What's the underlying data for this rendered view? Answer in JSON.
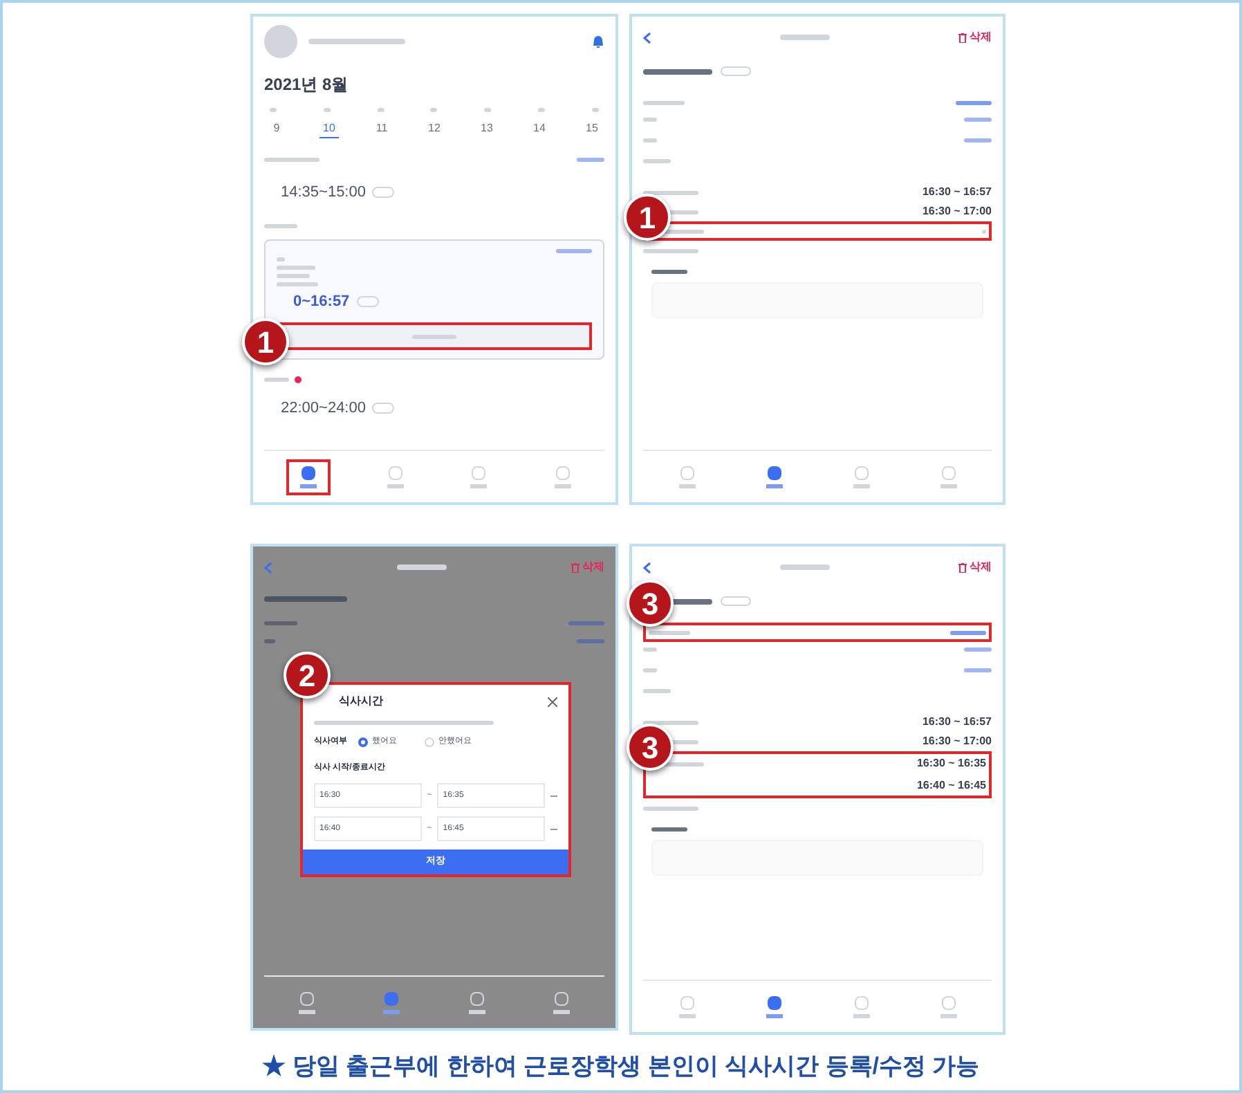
{
  "top_row": {
    "left": {
      "kind": "calendar",
      "month": "2021년 8월",
      "dates": [
        {
          "label": "9",
          "selected": false
        },
        {
          "label": "10",
          "selected": true
        },
        {
          "label": "11",
          "selected": false
        },
        {
          "label": "12",
          "selected": false
        },
        {
          "label": "13",
          "selected": false
        },
        {
          "label": "14",
          "selected": false
        },
        {
          "label": "15",
          "selected": false
        }
      ],
      "slots": [
        "14:35~15:00",
        "0~16:57",
        "22:00~24:00"
      ],
      "tabs": [
        {
          "selected": true
        },
        {
          "selected": false
        },
        {
          "selected": false
        },
        {
          "selected": false
        }
      ],
      "callouts": [
        "1"
      ]
    },
    "right": {
      "kind": "detail",
      "delete_label": "삭제",
      "times": [
        "16:30 ~ 16:57",
        "16:30 ~ 17:00"
      ],
      "tabs": [
        {
          "selected": false
        },
        {
          "selected": true
        },
        {
          "selected": false
        },
        {
          "selected": false
        }
      ],
      "callouts": [
        "1"
      ]
    }
  },
  "bottom_row": {
    "left": {
      "kind": "modal",
      "delete_label": "삭제",
      "modal": {
        "title": "식사시간",
        "question": "식사여부",
        "options": [
          {
            "label": "했어요",
            "selected": true
          },
          {
            "label": "안했어요",
            "selected": false
          }
        ],
        "range_label": "식사 시작/종료시간",
        "range_separator": "~",
        "ranges": [
          [
            "16:30",
            "16:35"
          ],
          [
            "16:40",
            "16:45"
          ]
        ],
        "save": "저장"
      },
      "tabs": [
        {
          "selected": false
        },
        {
          "selected": true
        },
        {
          "selected": false
        },
        {
          "selected": false
        }
      ],
      "callouts": [
        "2"
      ]
    },
    "right": {
      "kind": "detail",
      "delete_label": "삭제",
      "times": [
        "16:30 ~ 16:57",
        "16:30 ~ 17:00",
        "16:30 ~ 16:35",
        "16:40 ~ 16:45"
      ],
      "tabs": [
        {
          "selected": false
        },
        {
          "selected": true
        },
        {
          "selected": false
        },
        {
          "selected": false
        }
      ],
      "callouts": [
        "3",
        "3"
      ]
    }
  },
  "caption": "★ 당일 출근부에 한하여 근로장학생 본인이 식사시간 등록/수정 가능"
}
